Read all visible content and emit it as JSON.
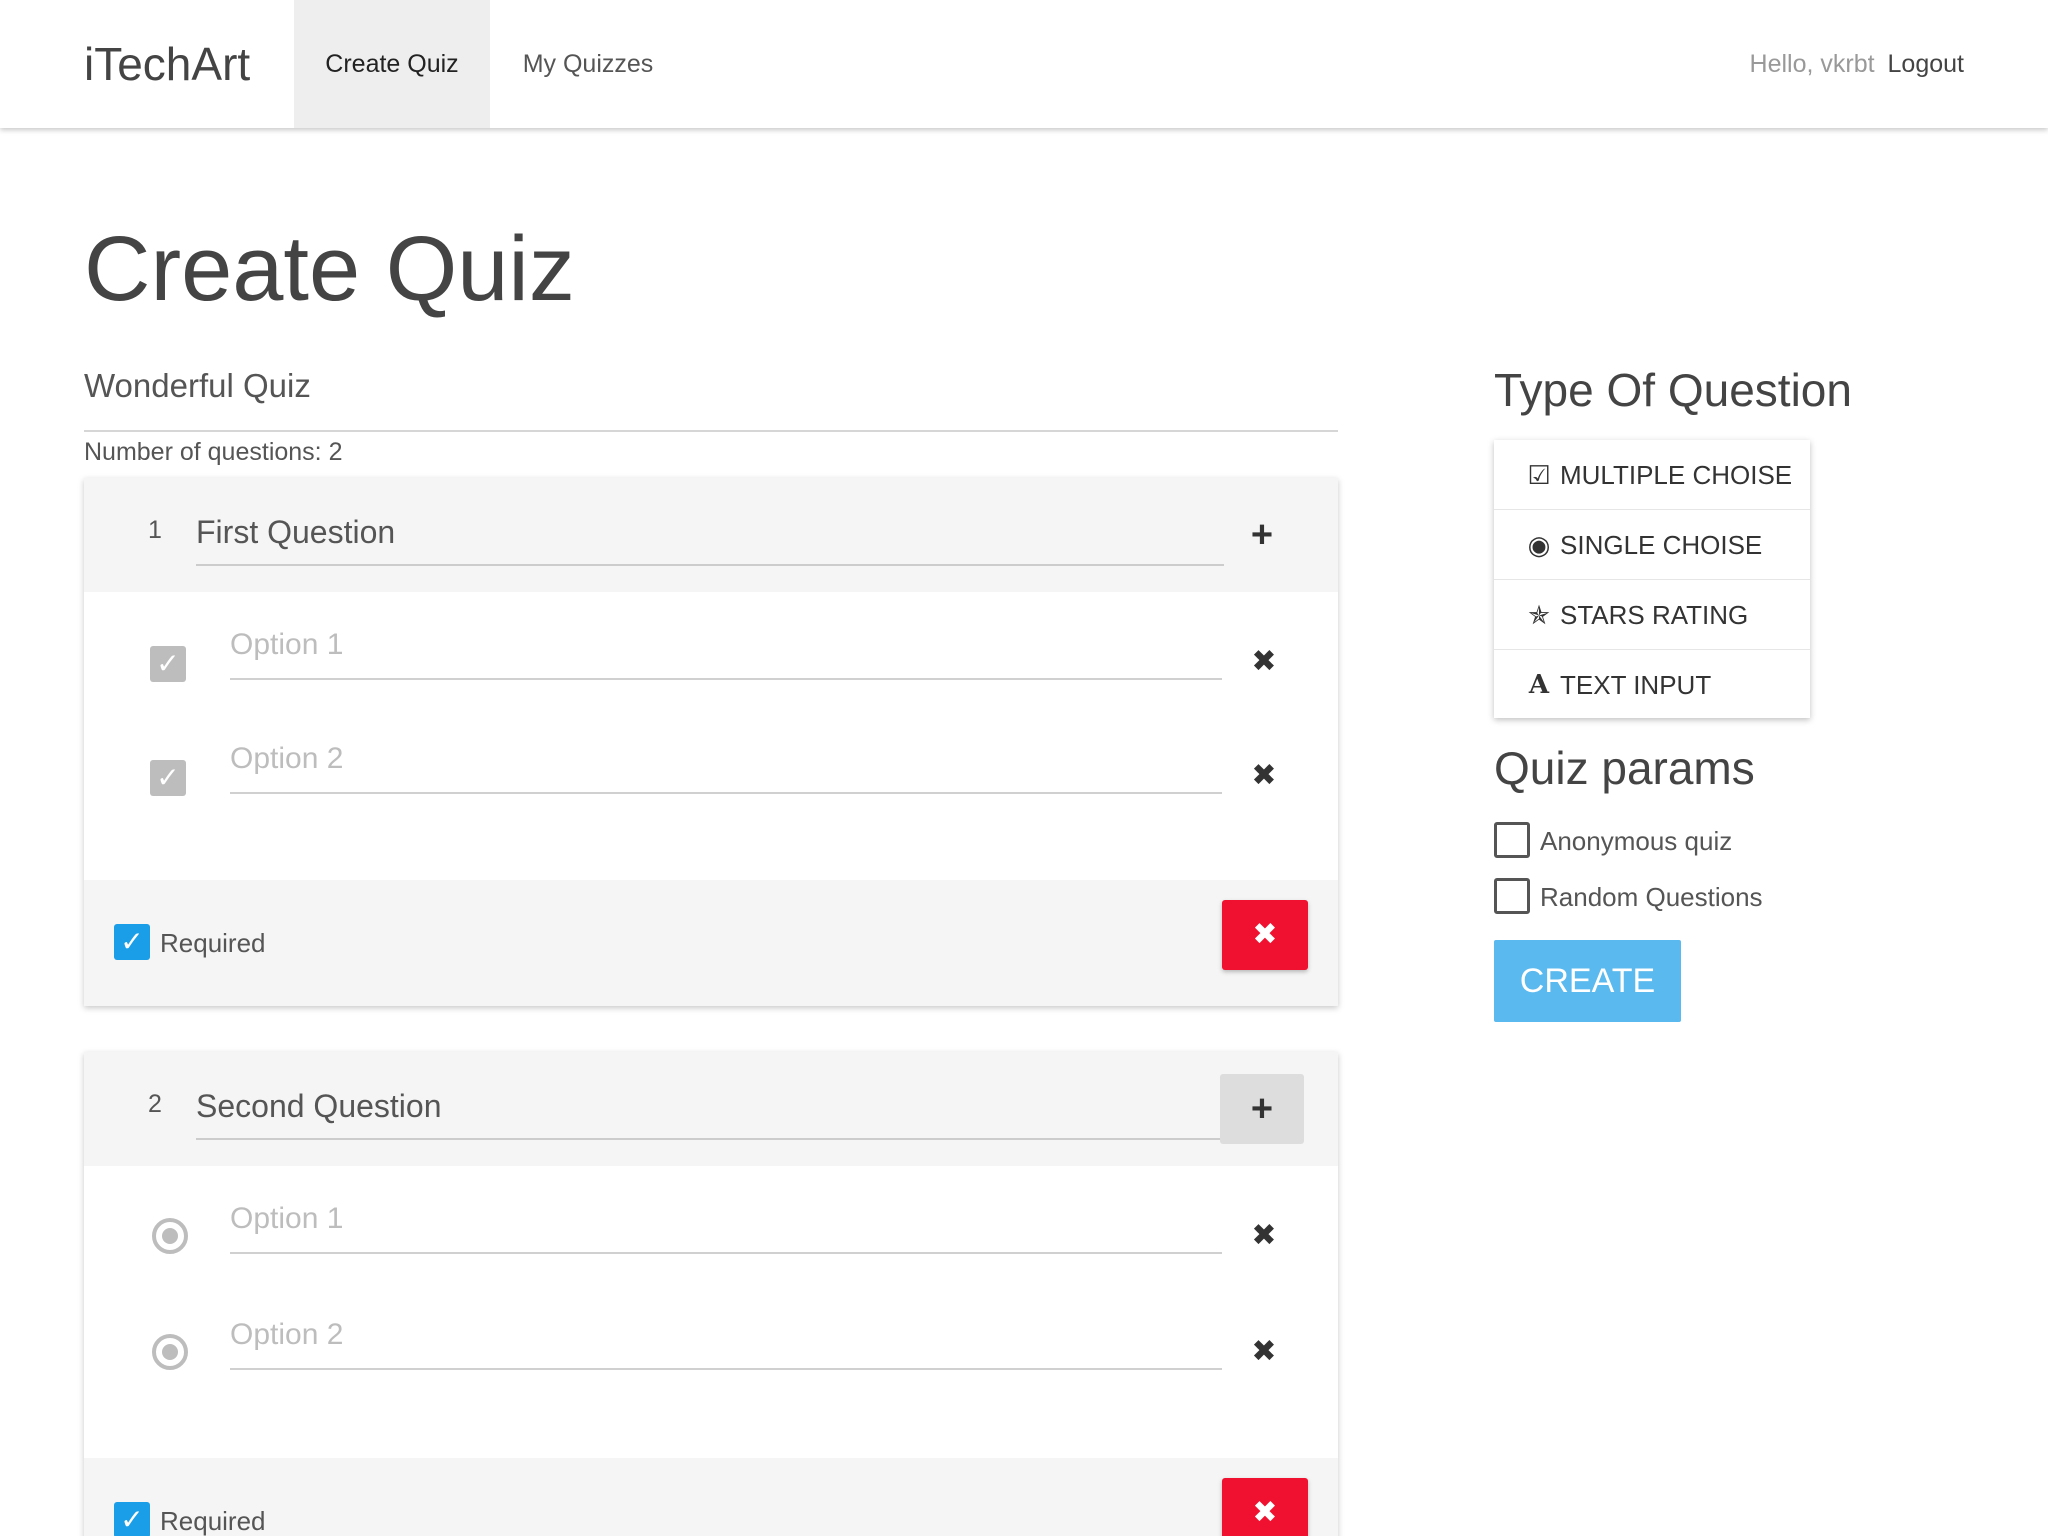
{
  "nav": {
    "brand": "iTechArt",
    "items": [
      {
        "label": "Create Quiz",
        "active": true
      },
      {
        "label": "My Quizzes",
        "active": false
      }
    ],
    "greeting": "Hello, vkrbt",
    "logout": "Logout"
  },
  "page": {
    "title": "Create Quiz"
  },
  "quiz": {
    "title": "Wonderful Quiz",
    "count_text": "Number of questions: 2"
  },
  "questions": [
    {
      "number": "1",
      "title": "First Question",
      "add_icon": "+",
      "option_type": "checkbox",
      "options": [
        {
          "placeholder": "Option 1",
          "remove_icon": "✖"
        },
        {
          "placeholder": "Option 2",
          "remove_icon": "✖"
        }
      ],
      "required_label": "Required",
      "required_checked": true,
      "remove_icon": "✖"
    },
    {
      "number": "2",
      "title": "Second Question",
      "add_icon": "+",
      "option_type": "radio",
      "options": [
        {
          "placeholder": "Option 1",
          "remove_icon": "✖"
        },
        {
          "placeholder": "Option 2",
          "remove_icon": "✖"
        }
      ],
      "required_label": "Required",
      "required_checked": true,
      "remove_icon": "✖"
    }
  ],
  "types_panel": {
    "title": "Type Of Question",
    "items": [
      {
        "icon": "checkbox-checked-icon",
        "glyph": "☑",
        "label": "MULTIPLE CHOISE"
      },
      {
        "icon": "radio-dot-icon",
        "glyph": "◉",
        "label": "SINGLE CHOISE"
      },
      {
        "icon": "star-half-icon",
        "glyph": "✯",
        "label": "STARS RATING"
      },
      {
        "icon": "font-letter-icon",
        "glyph": "A",
        "label": "TEXT INPUT"
      }
    ]
  },
  "params": {
    "title": "Quiz params",
    "items": [
      {
        "label": "Anonymous quiz",
        "checked": false
      },
      {
        "label": "Random Questions",
        "checked": false
      }
    ]
  },
  "create_button": "CREATE",
  "colors": {
    "accent_blue": "#5ab9ee",
    "checkbox_blue": "#1a9ee8",
    "danger_red": "#f0102f",
    "nav_active_bg": "#eeeeee"
  }
}
